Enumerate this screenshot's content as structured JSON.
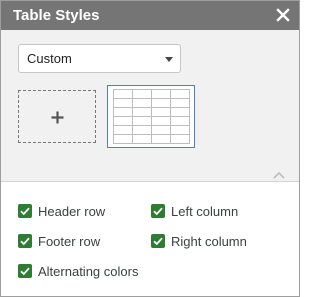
{
  "dialog": {
    "title": "Table Styles",
    "close_icon": "close-icon"
  },
  "style_picker": {
    "selected_value": "Custom",
    "add_icon": "plus-icon",
    "collapse_icon": "chevron-up-icon"
  },
  "options": {
    "header_row": {
      "label": "Header row",
      "checked": true
    },
    "left_column": {
      "label": "Left column",
      "checked": true
    },
    "footer_row": {
      "label": "Footer row",
      "checked": true
    },
    "right_column": {
      "label": "Right column",
      "checked": true
    },
    "alternating_colors": {
      "label": "Alternating colors",
      "checked": true
    }
  },
  "colors": {
    "titlebar": "#757575",
    "checkbox": "#2e7d32",
    "selected_border": "#4a7fd6"
  }
}
